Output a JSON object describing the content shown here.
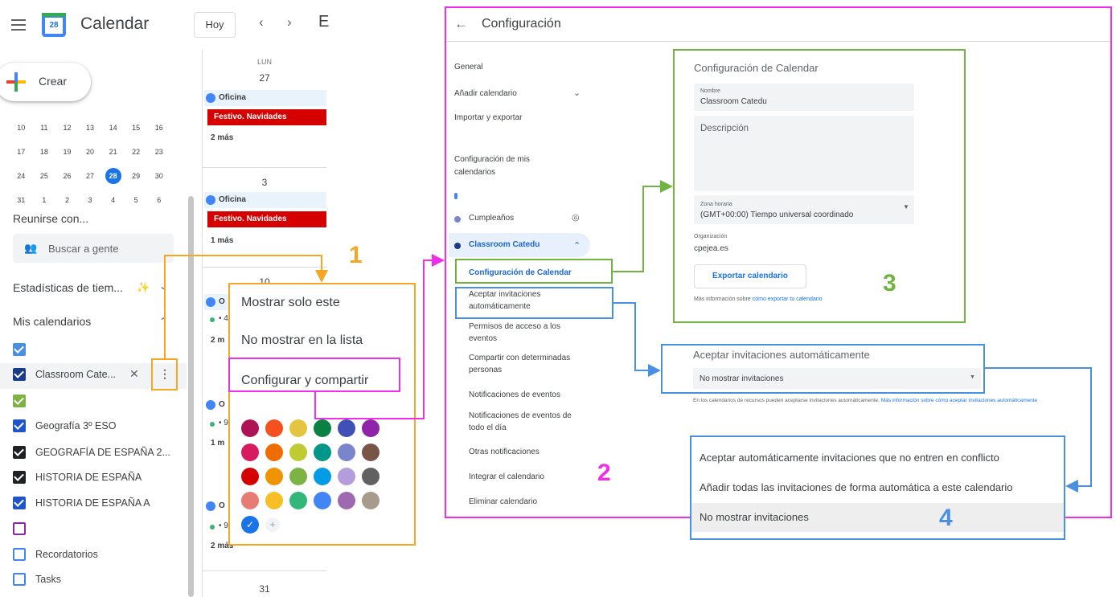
{
  "header": {
    "app_title": "Calendar",
    "logo_day": "28",
    "today_button": "Hoy",
    "prev_icon": "‹",
    "next_icon": "›",
    "partial_title": "E"
  },
  "create_button": {
    "label": "Crear"
  },
  "mini_calendar": {
    "rows": [
      [
        "10",
        "11",
        "12",
        "13",
        "14",
        "15",
        "16"
      ],
      [
        "17",
        "18",
        "19",
        "20",
        "21",
        "22",
        "23"
      ],
      [
        "24",
        "25",
        "26",
        "27",
        "28",
        "29",
        "30"
      ],
      [
        "31",
        "1",
        "2",
        "3",
        "4",
        "5",
        "6"
      ]
    ],
    "selected": "28"
  },
  "sidebar": {
    "meet_title": "Reunirse con...",
    "search_people": "Buscar a gente",
    "stats_title": "Estadísticas de tiem...",
    "my_calendars_title": "Mis calendarios",
    "calendars": [
      {
        "name": "",
        "color": "#4a90e2",
        "checked": true
      },
      {
        "name": "Classroom Cate...",
        "color": "#1a3a8a",
        "checked": true
      },
      {
        "name": "",
        "color": "#7cb342",
        "checked": true
      },
      {
        "name": "Geografía 3º ESO",
        "color": "#1e56c9",
        "checked": true
      },
      {
        "name": "GEOGRAFÍA DE ESPAÑA 2...",
        "color": "#202124",
        "checked": true
      },
      {
        "name": "HISTORIA DE ESPAÑA",
        "color": "#202124",
        "checked": true
      },
      {
        "name": "HISTORIA DE ESPAÑA A",
        "color": "#1e56c9",
        "checked": true
      },
      {
        "name": "",
        "color": "#8e24aa",
        "checked": false
      },
      {
        "name": "Recordatorios",
        "color": "#4285f4",
        "checked": false
      },
      {
        "name": "Tasks",
        "color": "#4285f4",
        "checked": false
      }
    ],
    "close_icon": "✕",
    "more_icon": "⋮"
  },
  "week": {
    "day_name": "LUN",
    "days": [
      {
        "num": "27",
        "blue_event": "Oficina",
        "red_event": "Festivo. Navidades",
        "more": "2 más"
      },
      {
        "num": "3",
        "blue_event": "Oficina",
        "red_event": "Festivo. Navidades",
        "more": "1 más"
      },
      {
        "num": "10"
      },
      {
        "num": "31"
      }
    ],
    "partial_items": [
      "O",
      "• 4",
      "2 m",
      "O",
      "• 9",
      "1 m",
      "O",
      "• 9",
      "2 más"
    ]
  },
  "menu": {
    "items": [
      "Mostrar solo este",
      "No mostrar en la lista",
      "Configurar y compartir"
    ],
    "swatches": [
      [
        "#ad1457",
        "#f4511e",
        "#e4c441",
        "#0b8043",
        "#3f51b5",
        "#8e24aa"
      ],
      [
        "#d81b60",
        "#ef6c00",
        "#c0ca33",
        "#009688",
        "#7986cb",
        "#795548"
      ],
      [
        "#d50000",
        "#f09300",
        "#7cb342",
        "#039be5",
        "#b39ddb",
        "#616161"
      ],
      [
        "#e67c73",
        "#f6bf26",
        "#33b679",
        "#4285f4",
        "#9e69af",
        "#a79b8e"
      ]
    ],
    "selected_swatch_color": "#1a73e8",
    "add_icon": "+"
  },
  "settings": {
    "back_icon": "←",
    "title": "Configuración",
    "nav": {
      "general": "General",
      "add_calendar": "Añadir calendario",
      "import_export": "Importar y exportar",
      "my_calendars_settings": "Configuración de mis calendarios",
      "birthdays": "Cumpleaños",
      "classroom": "Classroom Catedu",
      "sub": [
        "Configuración de Calendar",
        "Aceptar invitaciones automáticamente",
        "Permisos de acceso a los eventos",
        "Compartir con determinadas personas",
        "Notificaciones de eventos",
        "Notificaciones de eventos de todo el día",
        "Otras notificaciones",
        "Integrar el calendario",
        "Eliminar calendario"
      ]
    },
    "calendar_panel": {
      "title": "Configuración de Calendar",
      "name_label": "Nombre",
      "name_value": "Classroom Catedu",
      "description_placeholder": "Descripción",
      "tz_label": "Zona horaria",
      "tz_value": "(GMT+00:00) Tiempo universal coordinado",
      "org_label": "Organización",
      "org_value": "cpejea.es",
      "export_button": "Exportar calendario",
      "info_text": "Más información sobre ",
      "info_link": "cómo exportar tu calendario"
    },
    "accept_panel": {
      "title": "Aceptar invitaciones automáticamente",
      "select_value": "No mostrar invitaciones",
      "note_text": "En los calendarios de recursos pueden aceptarse invitaciones automáticamente.",
      "note_link": "Más información sobre cómo aceptar invitaciones automáticamente"
    },
    "options_panel": {
      "options": [
        "Aceptar automáticamente invitaciones que no entren en conflicto",
        "Añadir todas las invitaciones de forma automática a este calendario",
        "No mostrar invitaciones"
      ]
    }
  },
  "annotations": {
    "n1": "1",
    "n2": "2",
    "n3": "3",
    "n4": "4",
    "color_orange": "#f6a623",
    "color_magenta": "#ee2fe7",
    "color_green": "#71b340",
    "color_blue": "#4a90e2"
  }
}
